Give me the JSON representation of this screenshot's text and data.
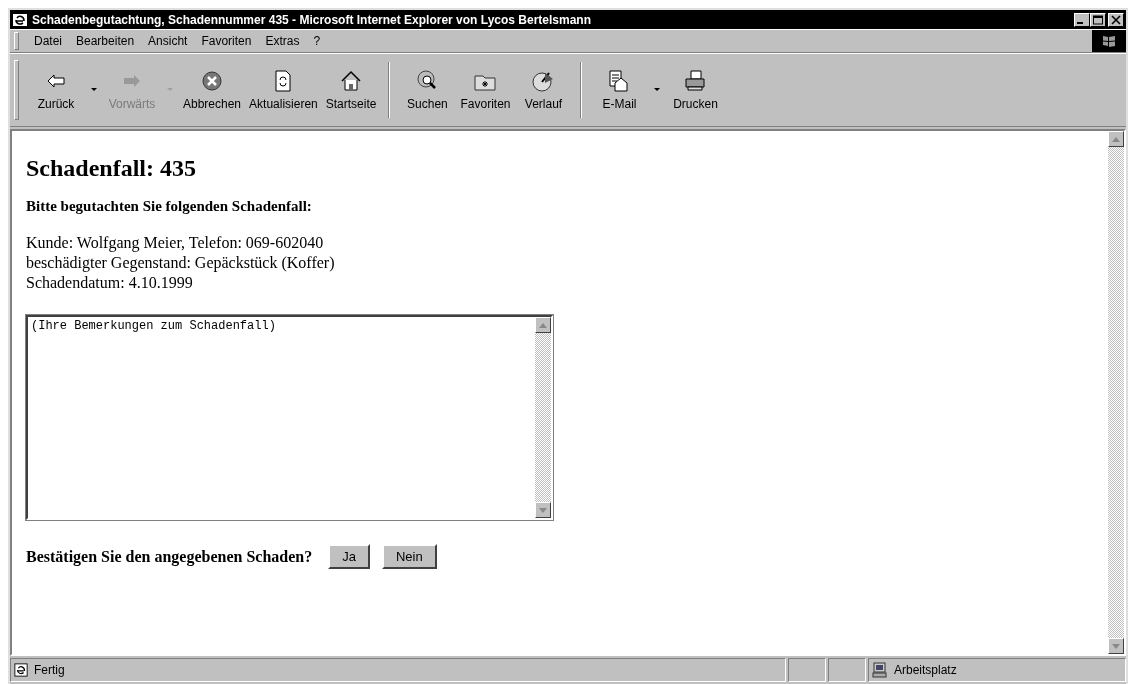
{
  "window": {
    "title": "Schadenbegutachtung, Schadennummer 435 - Microsoft Internet Explorer von Lycos Bertelsmann"
  },
  "menu": [
    "Datei",
    "Bearbeiten",
    "Ansicht",
    "Favoriten",
    "Extras",
    "?"
  ],
  "toolbar": [
    [
      {
        "label": "Zurück",
        "kind": "back",
        "disabled": false,
        "dropdown": true
      },
      {
        "label": "Vorwärts",
        "kind": "forward",
        "disabled": true,
        "dropdown": true
      },
      {
        "label": "Abbrechen",
        "kind": "stop",
        "disabled": false,
        "dropdown": false
      },
      {
        "label": "Aktualisieren",
        "kind": "refresh",
        "disabled": false,
        "dropdown": false
      },
      {
        "label": "Startseite",
        "kind": "home",
        "disabled": false,
        "dropdown": false
      }
    ],
    [
      {
        "label": "Suchen",
        "kind": "search",
        "disabled": false,
        "dropdown": false
      },
      {
        "label": "Favoriten",
        "kind": "folder",
        "disabled": false,
        "dropdown": false
      },
      {
        "label": "Verlauf",
        "kind": "history",
        "disabled": false,
        "dropdown": false
      }
    ],
    [
      {
        "label": "E-Mail",
        "kind": "mail",
        "disabled": false,
        "dropdown": true
      },
      {
        "label": "Drucken",
        "kind": "print",
        "disabled": false,
        "dropdown": false
      }
    ]
  ],
  "page": {
    "heading": "Schadenfall: 435",
    "subheading": "Bitte begutachten Sie folgenden Schadenfall:",
    "details": [
      "Kunde: Wolfgang Meier, Telefon: 069-602040",
      "beschädigter Gegenstand: Gepäckstück (Koffer)",
      "Schadendatum: 4.10.1999"
    ],
    "remarks": {
      "value": "(Ihre Bemerkungen zum Schadenfall)"
    },
    "question": "Bestätigen Sie den angegebenen Schaden?",
    "buttons": [
      "Ja",
      "Nein"
    ]
  },
  "status_bar": {
    "text": "Fertig",
    "zone": "Arbeitsplatz"
  }
}
